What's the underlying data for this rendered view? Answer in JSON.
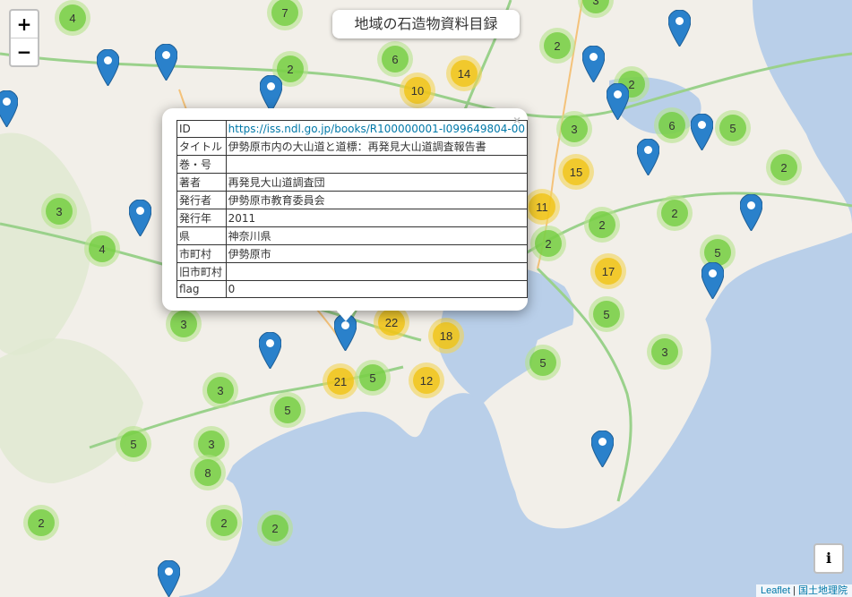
{
  "title": "地域の石造物資料目録",
  "zoom": {
    "in_label": "+",
    "out_label": "−"
  },
  "info_button": "i",
  "attribution": {
    "leaflet": "Leaflet",
    "separator": " | ",
    "gsi": "国土地理院"
  },
  "popup": {
    "close": "×",
    "rows": [
      {
        "key": "ID",
        "value": "https://iss.ndl.go.jp/books/R100000001-I099649804-00",
        "link": true
      },
      {
        "key": "タイトル",
        "value": "伊勢原市内の大山道と道標：再発見大山道調査報告書"
      },
      {
        "key": "巻・号",
        "value": ""
      },
      {
        "key": "著者",
        "value": "再発見大山道調査団"
      },
      {
        "key": "発行者",
        "value": "伊勢原市教育委員会"
      },
      {
        "key": "発行年",
        "value": "2011"
      },
      {
        "key": "県",
        "value": "神奈川県"
      },
      {
        "key": "市町村",
        "value": "伊勢原市"
      },
      {
        "key": "旧市町村",
        "value": ""
      },
      {
        "key": "flag",
        "value": "0"
      }
    ]
  },
  "colors": {
    "cluster_small": "#6ecc39",
    "cluster_medium": "#f0c20c",
    "marker": "#2a81cb",
    "sea": "#b9cfe9",
    "land": "#f2efe9"
  },
  "clusters": [
    {
      "count": "4",
      "size": "small"
    },
    {
      "count": "7",
      "size": "small"
    },
    {
      "count": "3",
      "size": "small"
    },
    {
      "count": "2",
      "size": "small"
    },
    {
      "count": "6",
      "size": "small"
    },
    {
      "count": "14",
      "size": "medium"
    },
    {
      "count": "10",
      "size": "medium"
    },
    {
      "count": "2",
      "size": "small"
    },
    {
      "count": "2",
      "size": "small"
    },
    {
      "count": "3",
      "size": "small"
    },
    {
      "count": "6",
      "size": "small"
    },
    {
      "count": "5",
      "size": "small"
    },
    {
      "count": "15",
      "size": "medium"
    },
    {
      "count": "2",
      "size": "small"
    },
    {
      "count": "11",
      "size": "medium"
    },
    {
      "count": "2",
      "size": "small"
    },
    {
      "count": "2",
      "size": "small"
    },
    {
      "count": "2",
      "size": "small"
    },
    {
      "count": "5",
      "size": "small"
    },
    {
      "count": "17",
      "size": "medium"
    },
    {
      "count": "3",
      "size": "small"
    },
    {
      "count": "4",
      "size": "small"
    },
    {
      "count": "3",
      "size": "small"
    },
    {
      "count": "22",
      "size": "medium"
    },
    {
      "count": "18",
      "size": "medium"
    },
    {
      "count": "5",
      "size": "small"
    },
    {
      "count": "3",
      "size": "small"
    },
    {
      "count": "21",
      "size": "medium"
    },
    {
      "count": "5",
      "size": "small"
    },
    {
      "count": "12",
      "size": "medium"
    },
    {
      "count": "5",
      "size": "small"
    },
    {
      "count": "3",
      "size": "small"
    },
    {
      "count": "5",
      "size": "small"
    },
    {
      "count": "5",
      "size": "small"
    },
    {
      "count": "3",
      "size": "small"
    },
    {
      "count": "8",
      "size": "small"
    },
    {
      "count": "2",
      "size": "small"
    },
    {
      "count": "2",
      "size": "small"
    },
    {
      "count": "2",
      "size": "small"
    }
  ]
}
